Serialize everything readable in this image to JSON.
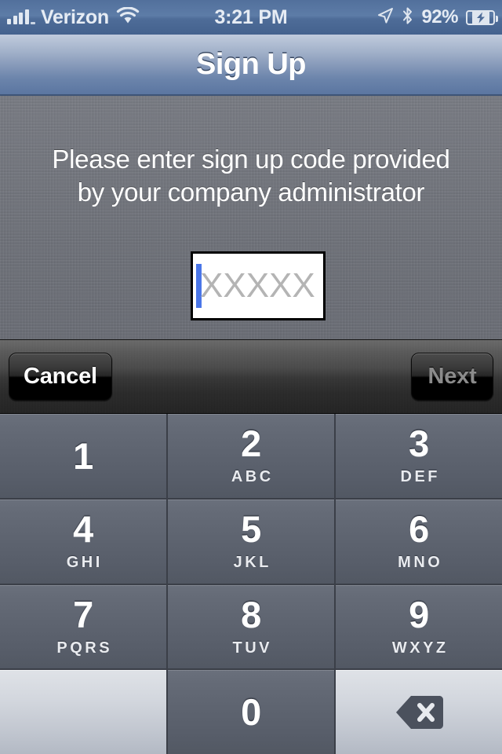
{
  "status_bar": {
    "carrier": "Verizon",
    "signal_icon": "signal-bars-icon",
    "wifi_icon": "wifi-icon",
    "time": "3:21 PM",
    "location_icon": "location-arrow-icon",
    "bluetooth_icon": "bluetooth-icon",
    "battery_percent": "92%",
    "battery_icon": "battery-charging-icon"
  },
  "nav_bar": {
    "title": "Sign Up"
  },
  "content": {
    "instruction_line1": "Please enter sign up code provided",
    "instruction_line2": "by your company administrator",
    "code_field": {
      "value": "",
      "placeholder": "XXXXX",
      "caret_color": "#4a76e8"
    }
  },
  "keyboard_toolbar": {
    "cancel_label": "Cancel",
    "next_label": "Next",
    "next_enabled": false
  },
  "keypad": {
    "keys": [
      {
        "digit": "1",
        "letters": "",
        "style": "dark"
      },
      {
        "digit": "2",
        "letters": "ABC",
        "style": "dark"
      },
      {
        "digit": "3",
        "letters": "DEF",
        "style": "dark"
      },
      {
        "digit": "4",
        "letters": "GHI",
        "style": "dark"
      },
      {
        "digit": "5",
        "letters": "JKL",
        "style": "dark"
      },
      {
        "digit": "6",
        "letters": "MNO",
        "style": "dark"
      },
      {
        "digit": "7",
        "letters": "PQRS",
        "style": "dark"
      },
      {
        "digit": "8",
        "letters": "TUV",
        "style": "dark"
      },
      {
        "digit": "9",
        "letters": "WXYZ",
        "style": "dark"
      },
      {
        "digit": "",
        "letters": "",
        "style": "light"
      },
      {
        "digit": "0",
        "letters": "",
        "style": "dark"
      },
      {
        "digit": "",
        "letters": "",
        "style": "light",
        "icon": "backspace-icon"
      }
    ]
  },
  "colors": {
    "nav_bar_top": "#c0cbdd",
    "nav_bar_bottom": "#5b76a1",
    "linen_background": "#73767e",
    "key_dark": "#5e6470",
    "key_light": "#d3d7de",
    "caret_blue": "#4a76e8",
    "placeholder_gray": "#b4b4b4"
  }
}
